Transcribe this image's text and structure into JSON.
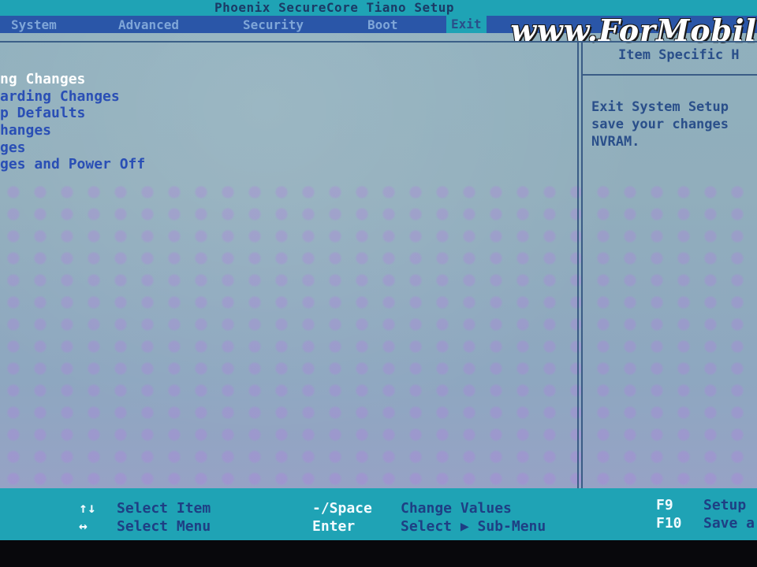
{
  "window": {
    "title": "Phoenix SecureCore Tiano Setup"
  },
  "menu": {
    "items": [
      {
        "label": "System"
      },
      {
        "label": "Advanced"
      },
      {
        "label": "Security"
      },
      {
        "label": "Boot"
      },
      {
        "label": "Exit",
        "selected": true
      }
    ]
  },
  "watermark": "www.ForMobil",
  "exit_options": [
    {
      "label": "ng Changes",
      "selected": true
    },
    {
      "label": "arding Changes"
    },
    {
      "label": "p Defaults"
    },
    {
      "label": "hanges"
    },
    {
      "label": "ges"
    },
    {
      "label": "ges and Power Off"
    }
  ],
  "help_panel": {
    "header": "Item Specific H",
    "lines": [
      "Exit System Setup",
      "save your changes",
      "NVRAM."
    ]
  },
  "footer": {
    "keys": [
      {
        "key": "↑↓",
        "desc": "Select Item"
      },
      {
        "key": "↔",
        "desc": "Select Menu"
      },
      {
        "key": "-/Space",
        "desc": "Change Values"
      },
      {
        "key": "Enter",
        "desc": "Select ▶ Sub-Menu"
      },
      {
        "key": "F9",
        "desc": "Setup"
      },
      {
        "key": "F10",
        "desc": "Save a"
      }
    ]
  },
  "colors": {
    "bar_cyan": "#1fa3b5",
    "menu_blue": "#2a56a8",
    "text_blue": "#2a4fb5",
    "selected_white": "#ffffff"
  }
}
